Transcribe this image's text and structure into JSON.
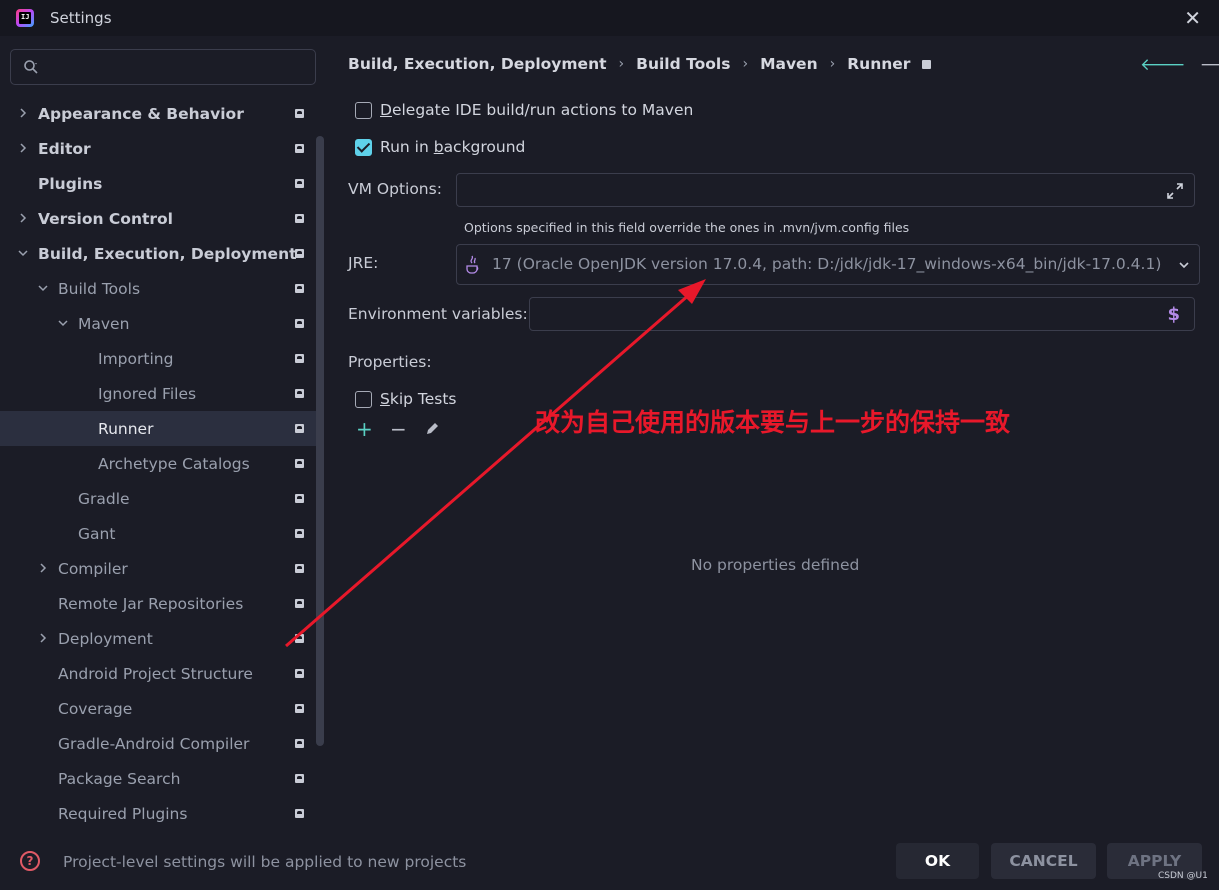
{
  "window": {
    "title": "Settings"
  },
  "search": {
    "placeholder": ""
  },
  "sidebar": {
    "items": [
      {
        "label": "Appearance & Behavior",
        "expanded": false,
        "level": 0,
        "bold": true
      },
      {
        "label": "Editor",
        "expanded": false,
        "level": 0,
        "bold": true
      },
      {
        "label": "Plugins",
        "level": 0,
        "bold": true
      },
      {
        "label": "Version Control",
        "expanded": false,
        "level": 0,
        "bold": true
      },
      {
        "label": "Build, Execution, Deployment",
        "expanded": true,
        "level": 0,
        "bold": true
      },
      {
        "label": "Build Tools",
        "expanded": true,
        "level": 1
      },
      {
        "label": "Maven",
        "expanded": true,
        "level": 2
      },
      {
        "label": "Importing",
        "level": 3
      },
      {
        "label": "Ignored Files",
        "level": 3
      },
      {
        "label": "Runner",
        "level": 3,
        "selected": true
      },
      {
        "label": "Archetype Catalogs",
        "level": 3
      },
      {
        "label": "Gradle",
        "level": 2
      },
      {
        "label": "Gant",
        "level": 2
      },
      {
        "label": "Compiler",
        "expanded": false,
        "level": 1
      },
      {
        "label": "Remote Jar Repositories",
        "level": 1
      },
      {
        "label": "Deployment",
        "expanded": false,
        "level": 1
      },
      {
        "label": "Android Project Structure",
        "level": 1
      },
      {
        "label": "Coverage",
        "level": 1
      },
      {
        "label": "Gradle-Android Compiler",
        "level": 1
      },
      {
        "label": "Package Search",
        "level": 1
      },
      {
        "label": "Required Plugins",
        "level": 1
      }
    ]
  },
  "breadcrumb": {
    "items": [
      "Build, Execution, Deployment",
      "Build Tools",
      "Maven",
      "Runner"
    ],
    "separator": "›"
  },
  "nav": {
    "back": "🡐",
    "forward": "🡒"
  },
  "runner": {
    "delegate": {
      "prefix": "",
      "mnemonic": "D",
      "rest": "elegate IDE build/run actions to Maven",
      "checked": false
    },
    "background": {
      "prefix": "Run in ",
      "mnemonic": "b",
      "rest": "ackground",
      "checked": true
    },
    "vm_options_label": "VM Options:",
    "vm_options_value": "",
    "vm_hint": "Options specified in this field override the ones in .mvn/jvm.config files",
    "jre_label": "JRE:",
    "jre_value": "17 (Oracle OpenJDK version 17.0.4, path: D:/jdk/jdk-17_windows-x64_bin/jdk-17.0.4.1)",
    "env_label": "Environment variables:",
    "env_value": "",
    "env_icon": "$",
    "properties_label": "Properties:",
    "skip_tests": {
      "mnemonic": "S",
      "rest": "kip Tests",
      "checked": false
    },
    "add_label": "+",
    "remove_label": "−",
    "empty_text": "No properties defined"
  },
  "annotation": {
    "text": "改为自己使用的版本要与上一步的保持一致",
    "color": "#e8182a"
  },
  "footer": {
    "help_icon": "?",
    "note": "Project-level settings will be applied to new projects",
    "ok": "OK",
    "cancel": "CANCEL",
    "apply": "APPLY"
  },
  "watermark": "CSDN @U1",
  "colors": {
    "accent": "#5fd1ea",
    "teal": "#5ad1c4",
    "annotation": "#e8182a",
    "selected_bg": "#2b2f3f"
  }
}
